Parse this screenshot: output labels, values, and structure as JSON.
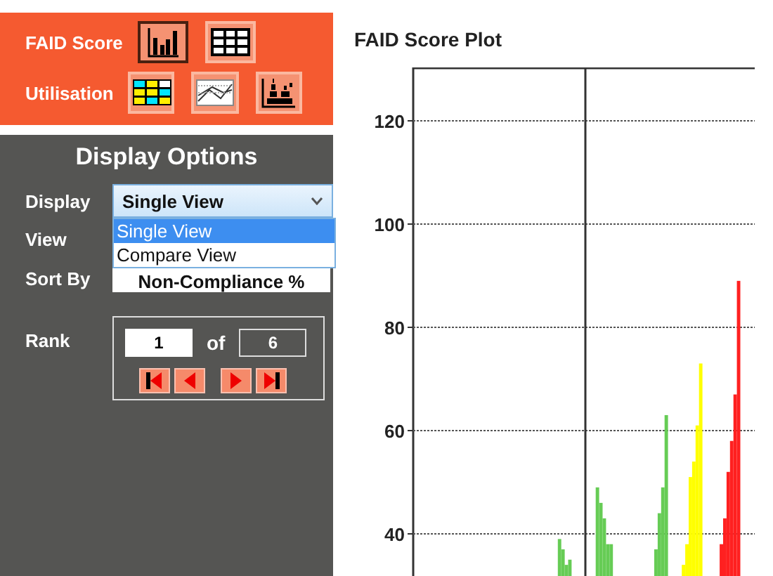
{
  "toolbar": {
    "rows": [
      {
        "label": "FAID Score",
        "tools": [
          {
            "kind": "bar-chart",
            "selected": true
          },
          {
            "kind": "table",
            "selected": false
          }
        ]
      },
      {
        "label": "Utilisation",
        "tools": [
          {
            "kind": "color-grid",
            "selected": false
          },
          {
            "kind": "line-chart",
            "selected": false
          },
          {
            "kind": "stacked-chart",
            "selected": false
          }
        ]
      }
    ]
  },
  "display_options": {
    "title": "Display Options",
    "display": {
      "label": "Display",
      "value": "Single View",
      "expanded": true,
      "options": [
        {
          "label": "Single View",
          "selected": true
        },
        {
          "label": "Compare View",
          "selected": false
        }
      ]
    },
    "view": {
      "label": "View"
    },
    "sort_by": {
      "label": "Sort By",
      "value": "Non-Compliance %"
    },
    "rank": {
      "label": "Rank",
      "value": "1",
      "of": "of",
      "total": "6"
    }
  },
  "chart": {
    "title": "FAID Score Plot",
    "y_axis_labels": [
      "120",
      "100",
      "80",
      "60",
      "40"
    ]
  }
}
